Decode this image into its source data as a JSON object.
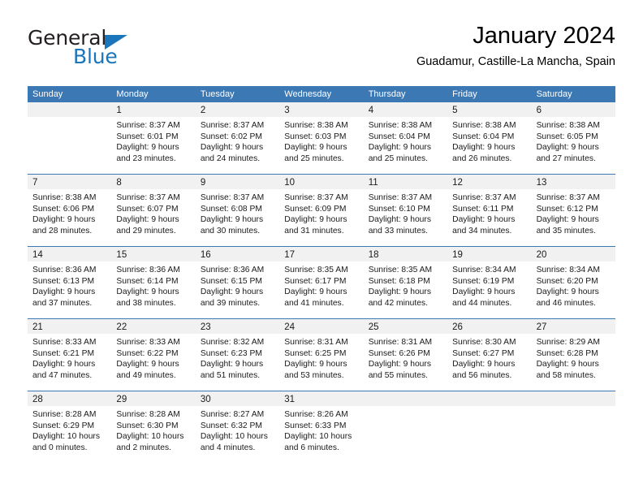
{
  "brand": {
    "name_part1": "General",
    "name_part2": "Blue",
    "triangle_icon": "triangle-icon",
    "colors": {
      "text": "#231f20",
      "accent": "#1b75bb"
    }
  },
  "header": {
    "title": "January 2024",
    "subtitle": "Guadamur, Castille-La Mancha, Spain"
  },
  "calendar": {
    "header_bg": "#3c78b4",
    "daynum_bg": "#f1f1f1",
    "weekdays": [
      "Sunday",
      "Monday",
      "Tuesday",
      "Wednesday",
      "Thursday",
      "Friday",
      "Saturday"
    ],
    "weeks": [
      [
        {
          "day": "",
          "sunrise": "",
          "sunset": "",
          "daylight1": "",
          "daylight2": ""
        },
        {
          "day": "1",
          "sunrise": "Sunrise: 8:37 AM",
          "sunset": "Sunset: 6:01 PM",
          "daylight1": "Daylight: 9 hours",
          "daylight2": "and 23 minutes."
        },
        {
          "day": "2",
          "sunrise": "Sunrise: 8:37 AM",
          "sunset": "Sunset: 6:02 PM",
          "daylight1": "Daylight: 9 hours",
          "daylight2": "and 24 minutes."
        },
        {
          "day": "3",
          "sunrise": "Sunrise: 8:38 AM",
          "sunset": "Sunset: 6:03 PM",
          "daylight1": "Daylight: 9 hours",
          "daylight2": "and 25 minutes."
        },
        {
          "day": "4",
          "sunrise": "Sunrise: 8:38 AM",
          "sunset": "Sunset: 6:04 PM",
          "daylight1": "Daylight: 9 hours",
          "daylight2": "and 25 minutes."
        },
        {
          "day": "5",
          "sunrise": "Sunrise: 8:38 AM",
          "sunset": "Sunset: 6:04 PM",
          "daylight1": "Daylight: 9 hours",
          "daylight2": "and 26 minutes."
        },
        {
          "day": "6",
          "sunrise": "Sunrise: 8:38 AM",
          "sunset": "Sunset: 6:05 PM",
          "daylight1": "Daylight: 9 hours",
          "daylight2": "and 27 minutes."
        }
      ],
      [
        {
          "day": "7",
          "sunrise": "Sunrise: 8:38 AM",
          "sunset": "Sunset: 6:06 PM",
          "daylight1": "Daylight: 9 hours",
          "daylight2": "and 28 minutes."
        },
        {
          "day": "8",
          "sunrise": "Sunrise: 8:37 AM",
          "sunset": "Sunset: 6:07 PM",
          "daylight1": "Daylight: 9 hours",
          "daylight2": "and 29 minutes."
        },
        {
          "day": "9",
          "sunrise": "Sunrise: 8:37 AM",
          "sunset": "Sunset: 6:08 PM",
          "daylight1": "Daylight: 9 hours",
          "daylight2": "and 30 minutes."
        },
        {
          "day": "10",
          "sunrise": "Sunrise: 8:37 AM",
          "sunset": "Sunset: 6:09 PM",
          "daylight1": "Daylight: 9 hours",
          "daylight2": "and 31 minutes."
        },
        {
          "day": "11",
          "sunrise": "Sunrise: 8:37 AM",
          "sunset": "Sunset: 6:10 PM",
          "daylight1": "Daylight: 9 hours",
          "daylight2": "and 33 minutes."
        },
        {
          "day": "12",
          "sunrise": "Sunrise: 8:37 AM",
          "sunset": "Sunset: 6:11 PM",
          "daylight1": "Daylight: 9 hours",
          "daylight2": "and 34 minutes."
        },
        {
          "day": "13",
          "sunrise": "Sunrise: 8:37 AM",
          "sunset": "Sunset: 6:12 PM",
          "daylight1": "Daylight: 9 hours",
          "daylight2": "and 35 minutes."
        }
      ],
      [
        {
          "day": "14",
          "sunrise": "Sunrise: 8:36 AM",
          "sunset": "Sunset: 6:13 PM",
          "daylight1": "Daylight: 9 hours",
          "daylight2": "and 37 minutes."
        },
        {
          "day": "15",
          "sunrise": "Sunrise: 8:36 AM",
          "sunset": "Sunset: 6:14 PM",
          "daylight1": "Daylight: 9 hours",
          "daylight2": "and 38 minutes."
        },
        {
          "day": "16",
          "sunrise": "Sunrise: 8:36 AM",
          "sunset": "Sunset: 6:15 PM",
          "daylight1": "Daylight: 9 hours",
          "daylight2": "and 39 minutes."
        },
        {
          "day": "17",
          "sunrise": "Sunrise: 8:35 AM",
          "sunset": "Sunset: 6:17 PM",
          "daylight1": "Daylight: 9 hours",
          "daylight2": "and 41 minutes."
        },
        {
          "day": "18",
          "sunrise": "Sunrise: 8:35 AM",
          "sunset": "Sunset: 6:18 PM",
          "daylight1": "Daylight: 9 hours",
          "daylight2": "and 42 minutes."
        },
        {
          "day": "19",
          "sunrise": "Sunrise: 8:34 AM",
          "sunset": "Sunset: 6:19 PM",
          "daylight1": "Daylight: 9 hours",
          "daylight2": "and 44 minutes."
        },
        {
          "day": "20",
          "sunrise": "Sunrise: 8:34 AM",
          "sunset": "Sunset: 6:20 PM",
          "daylight1": "Daylight: 9 hours",
          "daylight2": "and 46 minutes."
        }
      ],
      [
        {
          "day": "21",
          "sunrise": "Sunrise: 8:33 AM",
          "sunset": "Sunset: 6:21 PM",
          "daylight1": "Daylight: 9 hours",
          "daylight2": "and 47 minutes."
        },
        {
          "day": "22",
          "sunrise": "Sunrise: 8:33 AM",
          "sunset": "Sunset: 6:22 PM",
          "daylight1": "Daylight: 9 hours",
          "daylight2": "and 49 minutes."
        },
        {
          "day": "23",
          "sunrise": "Sunrise: 8:32 AM",
          "sunset": "Sunset: 6:23 PM",
          "daylight1": "Daylight: 9 hours",
          "daylight2": "and 51 minutes."
        },
        {
          "day": "24",
          "sunrise": "Sunrise: 8:31 AM",
          "sunset": "Sunset: 6:25 PM",
          "daylight1": "Daylight: 9 hours",
          "daylight2": "and 53 minutes."
        },
        {
          "day": "25",
          "sunrise": "Sunrise: 8:31 AM",
          "sunset": "Sunset: 6:26 PM",
          "daylight1": "Daylight: 9 hours",
          "daylight2": "and 55 minutes."
        },
        {
          "day": "26",
          "sunrise": "Sunrise: 8:30 AM",
          "sunset": "Sunset: 6:27 PM",
          "daylight1": "Daylight: 9 hours",
          "daylight2": "and 56 minutes."
        },
        {
          "day": "27",
          "sunrise": "Sunrise: 8:29 AM",
          "sunset": "Sunset: 6:28 PM",
          "daylight1": "Daylight: 9 hours",
          "daylight2": "and 58 minutes."
        }
      ],
      [
        {
          "day": "28",
          "sunrise": "Sunrise: 8:28 AM",
          "sunset": "Sunset: 6:29 PM",
          "daylight1": "Daylight: 10 hours",
          "daylight2": "and 0 minutes."
        },
        {
          "day": "29",
          "sunrise": "Sunrise: 8:28 AM",
          "sunset": "Sunset: 6:30 PM",
          "daylight1": "Daylight: 10 hours",
          "daylight2": "and 2 minutes."
        },
        {
          "day": "30",
          "sunrise": "Sunrise: 8:27 AM",
          "sunset": "Sunset: 6:32 PM",
          "daylight1": "Daylight: 10 hours",
          "daylight2": "and 4 minutes."
        },
        {
          "day": "31",
          "sunrise": "Sunrise: 8:26 AM",
          "sunset": "Sunset: 6:33 PM",
          "daylight1": "Daylight: 10 hours",
          "daylight2": "and 6 minutes."
        },
        {
          "day": "",
          "sunrise": "",
          "sunset": "",
          "daylight1": "",
          "daylight2": ""
        },
        {
          "day": "",
          "sunrise": "",
          "sunset": "",
          "daylight1": "",
          "daylight2": ""
        },
        {
          "day": "",
          "sunrise": "",
          "sunset": "",
          "daylight1": "",
          "daylight2": ""
        }
      ]
    ]
  }
}
